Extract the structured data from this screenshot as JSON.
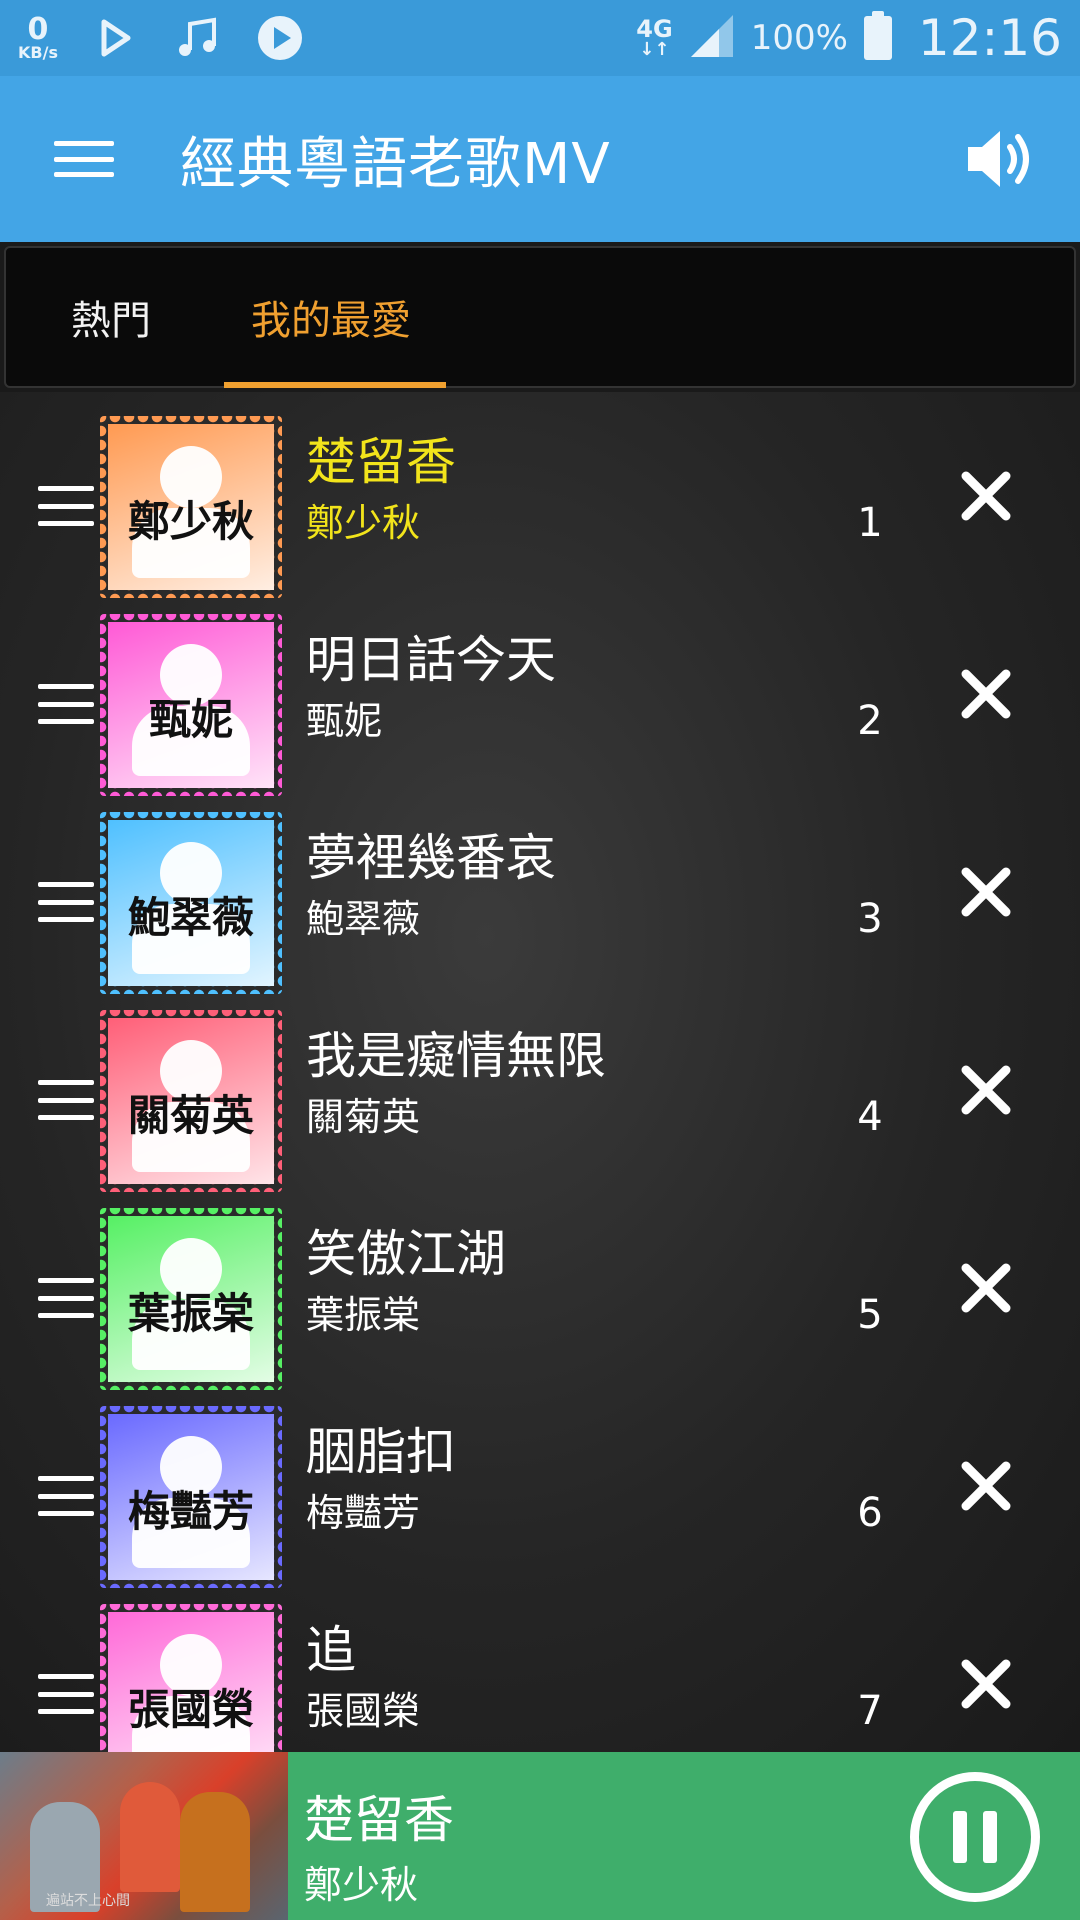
{
  "status_bar": {
    "speed_value": "0",
    "speed_unit": "KB/s",
    "network": "4G",
    "network_arrows": "↓↑",
    "battery": "100%",
    "time": "12:16"
  },
  "app_bar": {
    "title": "經典粵語老歌MV"
  },
  "tabs": {
    "hot": "熱門",
    "favorites": "我的最愛"
  },
  "playlist": [
    {
      "song": "楚留香",
      "artist": "鄭少秋",
      "index": "1",
      "stamp_color": "#ff9a52",
      "active": true
    },
    {
      "song": "明日話今天",
      "artist": "甄妮",
      "index": "2",
      "stamp_color": "#ff5ad6",
      "active": false
    },
    {
      "song": "夢裡幾番哀",
      "artist": "鮑翠薇",
      "index": "3",
      "stamp_color": "#4fc0ff",
      "active": false
    },
    {
      "song": "我是癡情無限",
      "artist": "關菊英",
      "index": "4",
      "stamp_color": "#ff5f78",
      "active": false
    },
    {
      "song": "笑傲江湖",
      "artist": "葉振棠",
      "index": "5",
      "stamp_color": "#56f064",
      "active": false
    },
    {
      "song": "胭脂扣",
      "artist": "梅豔芳",
      "index": "6",
      "stamp_color": "#6a6aff",
      "active": false
    },
    {
      "song": "追",
      "artist": "張國榮",
      "index": "7",
      "stamp_color": "#ff6ad8",
      "active": false
    }
  ],
  "player": {
    "song": "楚留香",
    "artist": "鄭少秋",
    "video_caption": "遍站不上心間"
  },
  "colors": {
    "status_bar": "#3a9ad9",
    "app_bar": "#43a5e6",
    "tab_active": "#f0a030",
    "active_song": "#f2e41b",
    "player": "#3fae6b"
  }
}
